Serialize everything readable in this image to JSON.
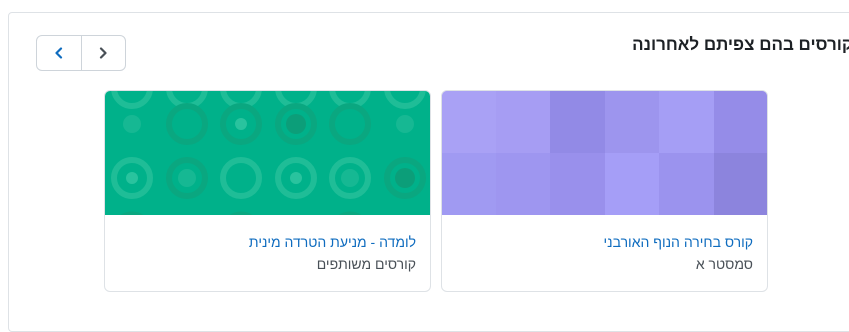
{
  "block": {
    "title": "קורסים בהם צפיתם לאחרונה"
  },
  "navigation": {
    "prev_icon": "chevron-left-icon",
    "next_icon": "chevron-right-icon",
    "prev_color": "#0f6cbf",
    "next_color": "#495057"
  },
  "courses": [
    {
      "name": "קורס בחירה הנוף האורבני",
      "category": "סמסטר א",
      "image_pattern": "purple-squares",
      "accent": "#9f95f0"
    },
    {
      "name": "לומדה - מניעת הטרדה מינית",
      "category": "קורסים משותפים",
      "image_pattern": "green-circles",
      "accent": "#00b18a"
    }
  ]
}
